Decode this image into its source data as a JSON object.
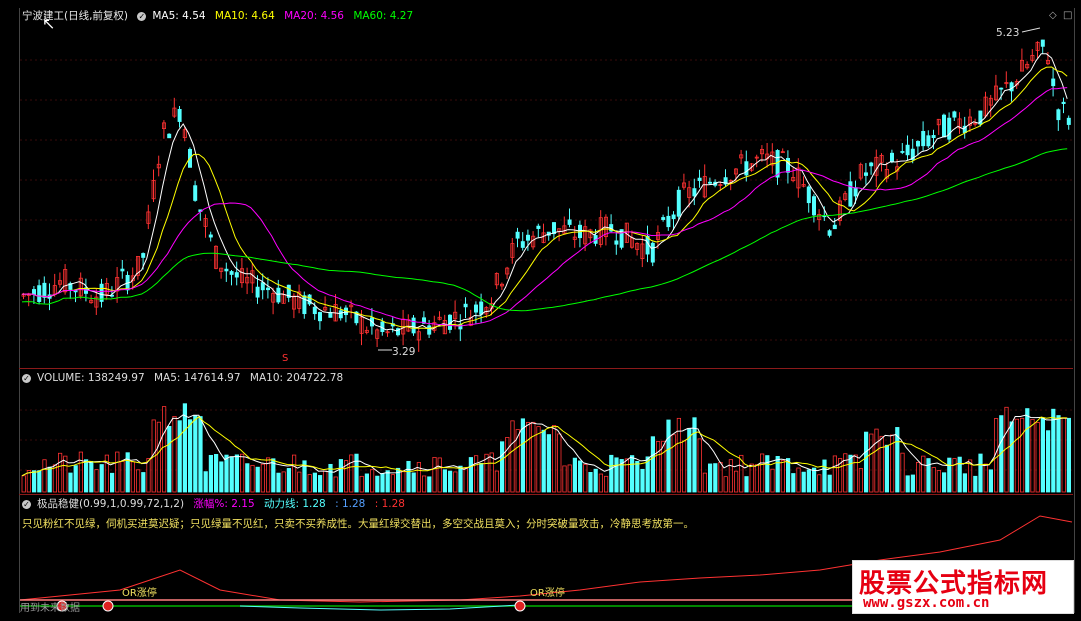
{
  "main": {
    "title": "宁波建工(日线,前复权)",
    "ma5": "MA5: 4.54",
    "ma10": "MA10: 4.64",
    "ma20": "MA20: 4.56",
    "ma60": "MA60: 4.27",
    "high_label": "5.23",
    "low_label": "3.29",
    "s_mark": "S"
  },
  "volume": {
    "label": "VOLUME: 138249.97",
    "ma5": "MA5: 147614.97",
    "ma10": "MA10: 204722.78"
  },
  "indicator": {
    "name": "极品稳健(0.99,1,0.99,72,1,2)",
    "zf": "涨幅%: 2.15",
    "dl": "动力线: 1.28",
    "v3": ": 1.28",
    "v4": ": 1.28",
    "note": "只见粉红不见绿，伺机买进莫迟疑；只见绿量不见红，只卖不买养成性。大量红绿交替出，多空交战且莫入；分时突破量攻击，冷静思考放第一。",
    "badge1": "OR涨停",
    "badge2": "OR涨停",
    "foot": "用到未来数据"
  },
  "watermark": {
    "line1": "股票公式指标网",
    "line2": "www.gszx.com.cn"
  },
  "colors": {
    "up": "#ff3232",
    "down": "#54ffff",
    "ma5": "#ffffff",
    "ma10": "#ffff00",
    "ma20": "#ff00ff",
    "ma60": "#00ff00",
    "sep": "#8b1a1a"
  },
  "icons": [
    "checkbox-icon",
    "diamond-icon",
    "square-icon",
    "cursor-icon",
    "arrow-up-icon"
  ]
}
